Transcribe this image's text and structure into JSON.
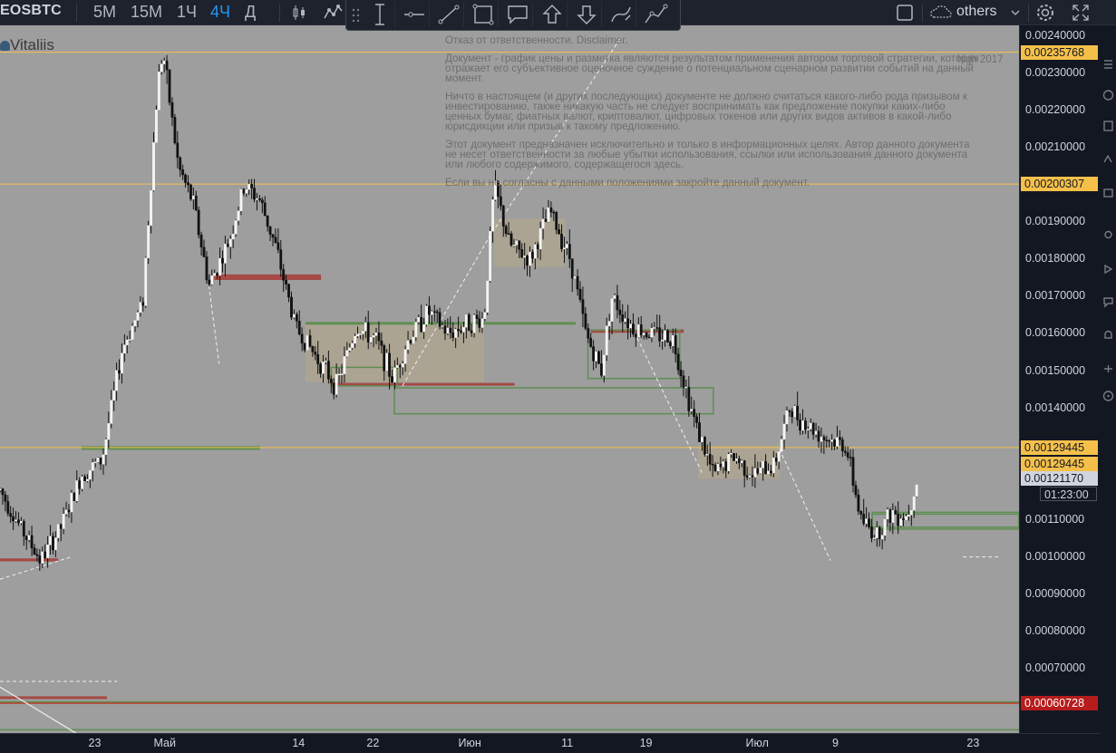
{
  "toolbar": {
    "symbol": "EOSBTC",
    "timeframes": [
      {
        "label": "5M",
        "active": false
      },
      {
        "label": "15M",
        "active": false
      },
      {
        "label": "1Ч",
        "active": false
      },
      {
        "label": "4Ч",
        "active": true
      },
      {
        "label": "Д",
        "active": false
      }
    ],
    "layout_name": "others",
    "icons": [
      "candles-icon",
      "indicators-icon",
      "layout-icon",
      "cloud-icon",
      "gear-icon",
      "fullscreen-icon"
    ]
  },
  "drawing_tools": [
    "grip-icon",
    "vertical-range-icon",
    "horizontal-line-icon",
    "trend-line-icon",
    "rectangle-icon",
    "callout-icon",
    "arrow-up-icon",
    "arrow-down-icon",
    "brush-icon",
    "path-icon"
  ],
  "chart": {
    "author": "Vitaliis",
    "high_label": "high 2017",
    "disclaimer": [
      "Отказ от ответственности. Disclaimer.",
      "Документ - график цены и разметка являются результатом применения автором торговой стратегии, которая отражает его субъективное оценочное суждение о потенциальном сценарном развитии событий на данный момент.",
      "Ничто в настоящем (и других последующих) документе не должно считаться какого-либо рода призывом к инвестированию, также никакую часть не следует воспринимать как предложение покупки каких-либо ценных бумаг, фиатных валют, криптовалют, цифровых токенов или других видов активов в какой-либо юрисдикции или призыв к такому предложению.",
      "Этот документ предназначен исключительно и только в информационных целях. Автор данного документа не несет ответственности за любые убытки использования, ссылки или использования данного документа или любого содержимого, содержащегося здесь.",
      "Если вы не согласны с данными положениями закройте данный документ."
    ]
  },
  "price_scale": {
    "ticks": [
      "0.00240000",
      "0.00230000",
      "0.00220000",
      "0.00210000",
      "0.00190000",
      "0.00180000",
      "0.00170000",
      "0.00160000",
      "0.00150000",
      "0.00140000",
      "0.00110000",
      "0.00100000",
      "0.00090000",
      "0.00080000",
      "0.00070000"
    ],
    "levels": [
      {
        "label": "0.00235768",
        "style": "y"
      },
      {
        "label": "0.00200307",
        "style": "y"
      },
      {
        "label": "0.00129445",
        "style": "y"
      },
      {
        "label": "0.00129445",
        "style": "y"
      },
      {
        "label": "0.00121170",
        "style": "g"
      },
      {
        "label": "0.00060728",
        "style": "r"
      }
    ],
    "countdown": "01:23:00",
    "colors": {
      "level_line": "#f5c04a",
      "support_zone": "#5e8f52",
      "resistance_zone": "#a54a44",
      "accent": "#2196f3"
    }
  },
  "time_axis": [
    "23",
    "Май",
    "14",
    "22",
    "Июн",
    "11",
    "19",
    "Июл",
    "9",
    "23"
  ],
  "chart_data": {
    "type": "candlestick",
    "symbol": "EOSBTC",
    "interval": "4Ч",
    "y_scale": "linear",
    "ylim": [
      0.00057,
      0.00243
    ],
    "y_ticks": [
      0.0024,
      0.0023,
      0.0022,
      0.0021,
      0.0019,
      0.0018,
      0.0017,
      0.0016,
      0.0015,
      0.0014,
      0.0011,
      0.001,
      0.0009,
      0.0008,
      0.0007
    ],
    "x_ticks": [
      "23",
      "Май",
      "14",
      "22",
      "Июн",
      "11",
      "19",
      "Июл",
      "9",
      "23"
    ],
    "close_path": [
      [
        0,
        0.00118
      ],
      [
        0.02,
        0.00108
      ],
      [
        0.04,
        0.00099
      ],
      [
        0.06,
        0.00108
      ],
      [
        0.08,
        0.00122
      ],
      [
        0.1,
        0.00126
      ],
      [
        0.12,
        0.00156
      ],
      [
        0.14,
        0.00168
      ],
      [
        0.155,
        0.00228
      ],
      [
        0.16,
        0.00236
      ],
      [
        0.175,
        0.00205
      ],
      [
        0.19,
        0.00195
      ],
      [
        0.205,
        0.00173
      ],
      [
        0.225,
        0.00185
      ],
      [
        0.24,
        0.002
      ],
      [
        0.255,
        0.00196
      ],
      [
        0.27,
        0.00184
      ],
      [
        0.29,
        0.00162
      ],
      [
        0.31,
        0.00154
      ],
      [
        0.33,
        0.00146
      ],
      [
        0.35,
        0.00162
      ],
      [
        0.37,
        0.00158
      ],
      [
        0.385,
        0.00148
      ],
      [
        0.4,
        0.00158
      ],
      [
        0.42,
        0.00166
      ],
      [
        0.44,
        0.0016
      ],
      [
        0.46,
        0.00163
      ],
      [
        0.475,
        0.00164
      ],
      [
        0.485,
        0.002
      ],
      [
        0.5,
        0.00184
      ],
      [
        0.52,
        0.0018
      ],
      [
        0.54,
        0.00193
      ],
      [
        0.56,
        0.0018
      ],
      [
        0.575,
        0.0016
      ],
      [
        0.59,
        0.0015
      ],
      [
        0.6,
        0.0017
      ],
      [
        0.62,
        0.00162
      ],
      [
        0.64,
        0.0016
      ],
      [
        0.66,
        0.00159
      ],
      [
        0.68,
        0.00138
      ],
      [
        0.7,
        0.00122
      ],
      [
        0.72,
        0.00127
      ],
      [
        0.74,
        0.00122
      ],
      [
        0.76,
        0.00125
      ],
      [
        0.775,
        0.0014
      ],
      [
        0.79,
        0.00136
      ],
      [
        0.81,
        0.00132
      ],
      [
        0.83,
        0.0013
      ],
      [
        0.845,
        0.0011
      ],
      [
        0.86,
        0.00106
      ],
      [
        0.875,
        0.00112
      ],
      [
        0.89,
        0.00111
      ],
      [
        0.9,
        0.00121
      ]
    ],
    "last_price": 0.0012117,
    "horizontal_levels": [
      0.00235768,
      0.00200307,
      0.00129445,
      0.00060728
    ],
    "zones": [
      {
        "kind": "resistance",
        "x": [
          0.21,
          0.315
        ],
        "y": [
          0.001745,
          0.00176
        ]
      },
      {
        "kind": "support",
        "x": [
          0.3,
          0.49
        ],
        "y": [
          0.001626,
          0.001632
        ]
      },
      {
        "kind": "support",
        "x": [
          0.49,
          0.565
        ],
        "y": [
          0.001626,
          0.001632
        ]
      },
      {
        "kind": "resistance",
        "x": [
          0.325,
          0.505
        ],
        "y": [
          0.001462,
          0.001468
        ]
      },
      {
        "kind": "support",
        "x": [
          0.08,
          0.255
        ],
        "y": [
          0.001288,
          0.001298
        ]
      },
      {
        "kind": "resistance",
        "x": [
          0,
          0.057
        ],
        "y": [
          0.000988,
          0.000996
        ]
      },
      {
        "kind": "resistance",
        "x": [
          0.58,
          0.671
        ],
        "y": [
          0.001603,
          0.001612
        ]
      }
    ]
  }
}
